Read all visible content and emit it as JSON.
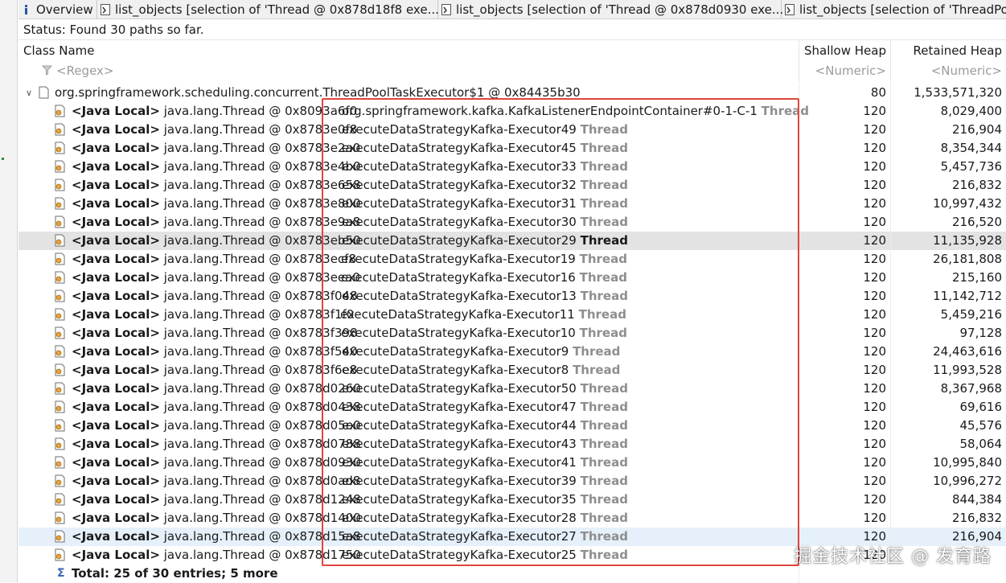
{
  "tabs": [
    {
      "label": "Overview",
      "icon": "info-icon"
    },
    {
      "label": "list_objects  [selection of 'Thread @ 0x878d18f8  exe...",
      "icon": "query-icon"
    },
    {
      "label": "list_objects  [selection of 'Thread @ 0x878d0930  exe...",
      "icon": "query-icon"
    },
    {
      "label": "list_objects  [selection of 'ThreadPo",
      "icon": "query-icon"
    }
  ],
  "status": "Status:  Found 30 paths so far.",
  "columns": {
    "class_name": "Class Name",
    "class_name_filter": "<Regex>",
    "shallow_heap": "Shallow Heap",
    "shallow_heap_filter": "<Numeric>",
    "retained_heap": "Retained Heap",
    "retained_heap_filter": "<Numeric>"
  },
  "root": {
    "label": "org.springframework.scheduling.concurrent.ThreadPoolTaskExecutor$1 @ 0x84435b30",
    "shallow": "80",
    "retained": "1,533,571,320"
  },
  "rows": [
    {
      "ref": "<Java Local>",
      "cls": "java.lang.Thread @ 0x8093a6f0",
      "name": "org.springframework.kafka.KafkaListenerEndpointContainer#0-1-C-1",
      "kind": "Thread",
      "shallow": "120",
      "retained": "8,029,400"
    },
    {
      "ref": "<Java Local>",
      "cls": "java.lang.Thread @ 0x8783e0f8",
      "name": "executeDataStrategyKafka-Executor49",
      "kind": "Thread",
      "shallow": "120",
      "retained": "216,904"
    },
    {
      "ref": "<Java Local>",
      "cls": "java.lang.Thread @ 0x8783e2a0",
      "name": "executeDataStrategyKafka-Executor45",
      "kind": "Thread",
      "shallow": "120",
      "retained": "8,354,344"
    },
    {
      "ref": "<Java Local>",
      "cls": "java.lang.Thread @ 0x8783e4b0",
      "name": "executeDataStrategyKafka-Executor33",
      "kind": "Thread",
      "shallow": "120",
      "retained": "5,457,736"
    },
    {
      "ref": "<Java Local>",
      "cls": "java.lang.Thread @ 0x8783e658",
      "name": "executeDataStrategyKafka-Executor32",
      "kind": "Thread",
      "shallow": "120",
      "retained": "216,832"
    },
    {
      "ref": "<Java Local>",
      "cls": "java.lang.Thread @ 0x8783e800",
      "name": "executeDataStrategyKafka-Executor31",
      "kind": "Thread",
      "shallow": "120",
      "retained": "10,997,432"
    },
    {
      "ref": "<Java Local>",
      "cls": "java.lang.Thread @ 0x8783e9a8",
      "name": "executeDataStrategyKafka-Executor30",
      "kind": "Thread",
      "shallow": "120",
      "retained": "216,520"
    },
    {
      "ref": "<Java Local>",
      "cls": "java.lang.Thread @ 0x8783eb50",
      "name": "executeDataStrategyKafka-Executor29",
      "kind": "Thread",
      "shallow": "120",
      "retained": "11,135,928"
    },
    {
      "ref": "<Java Local>",
      "cls": "java.lang.Thread @ 0x8783ecf8",
      "name": "executeDataStrategyKafka-Executor19",
      "kind": "Thread",
      "shallow": "120",
      "retained": "26,181,808"
    },
    {
      "ref": "<Java Local>",
      "cls": "java.lang.Thread @ 0x8783eea0",
      "name": "executeDataStrategyKafka-Executor16",
      "kind": "Thread",
      "shallow": "120",
      "retained": "215,160"
    },
    {
      "ref": "<Java Local>",
      "cls": "java.lang.Thread @ 0x8783f048",
      "name": "executeDataStrategyKafka-Executor13",
      "kind": "Thread",
      "shallow": "120",
      "retained": "11,142,712"
    },
    {
      "ref": "<Java Local>",
      "cls": "java.lang.Thread @ 0x8783f1f0",
      "name": "executeDataStrategyKafka-Executor11",
      "kind": "Thread",
      "shallow": "120",
      "retained": "5,459,216"
    },
    {
      "ref": "<Java Local>",
      "cls": "java.lang.Thread @ 0x8783f398",
      "name": "executeDataStrategyKafka-Executor10",
      "kind": "Thread",
      "shallow": "120",
      "retained": "97,128"
    },
    {
      "ref": "<Java Local>",
      "cls": "java.lang.Thread @ 0x8783f540",
      "name": "executeDataStrategyKafka-Executor9",
      "kind": "Thread",
      "shallow": "120",
      "retained": "24,463,616"
    },
    {
      "ref": "<Java Local>",
      "cls": "java.lang.Thread @ 0x8783f6e8",
      "name": "executeDataStrategyKafka-Executor8",
      "kind": "Thread",
      "shallow": "120",
      "retained": "11,993,528"
    },
    {
      "ref": "<Java Local>",
      "cls": "java.lang.Thread @ 0x878d0260",
      "name": "executeDataStrategyKafka-Executor50",
      "kind": "Thread",
      "shallow": "120",
      "retained": "8,367,968"
    },
    {
      "ref": "<Java Local>",
      "cls": "java.lang.Thread @ 0x878d0438",
      "name": "executeDataStrategyKafka-Executor47",
      "kind": "Thread",
      "shallow": "120",
      "retained": "69,616"
    },
    {
      "ref": "<Java Local>",
      "cls": "java.lang.Thread @ 0x878d05e0",
      "name": "executeDataStrategyKafka-Executor44",
      "kind": "Thread",
      "shallow": "120",
      "retained": "45,576"
    },
    {
      "ref": "<Java Local>",
      "cls": "java.lang.Thread @ 0x878d0788",
      "name": "executeDataStrategyKafka-Executor43",
      "kind": "Thread",
      "shallow": "120",
      "retained": "58,064"
    },
    {
      "ref": "<Java Local>",
      "cls": "java.lang.Thread @ 0x878d0930",
      "name": "executeDataStrategyKafka-Executor41",
      "kind": "Thread",
      "shallow": "120",
      "retained": "10,995,840"
    },
    {
      "ref": "<Java Local>",
      "cls": "java.lang.Thread @ 0x878d0ad8",
      "name": "executeDataStrategyKafka-Executor39",
      "kind": "Thread",
      "shallow": "120",
      "retained": "10,996,272"
    },
    {
      "ref": "<Java Local>",
      "cls": "java.lang.Thread @ 0x878d1248",
      "name": "executeDataStrategyKafka-Executor35",
      "kind": "Thread",
      "shallow": "120",
      "retained": "844,384"
    },
    {
      "ref": "<Java Local>",
      "cls": "java.lang.Thread @ 0x878d1400",
      "name": "executeDataStrategyKafka-Executor28",
      "kind": "Thread",
      "shallow": "120",
      "retained": "216,832"
    },
    {
      "ref": "<Java Local>",
      "cls": "java.lang.Thread @ 0x878d15a8",
      "name": "executeDataStrategyKafka-Executor27",
      "kind": "Thread",
      "shallow": "120",
      "retained": "216,904"
    },
    {
      "ref": "<Java Local>",
      "cls": "java.lang.Thread @ 0x878d1750",
      "name": "executeDataStrategyKafka-Executor25",
      "kind": "Thread",
      "shallow": "120",
      "retained": "",
      "hide_retained": true
    }
  ],
  "selected_index": 7,
  "hover_index": 23,
  "total_label": "Total: 25 of 30 entries; 5 more",
  "watermark": "掘金技术社区 @ 发育路",
  "colors": {
    "highlight_box": "#e0453d",
    "selected_row": "#e3e3e3",
    "hover_row": "#e6f0fa"
  }
}
